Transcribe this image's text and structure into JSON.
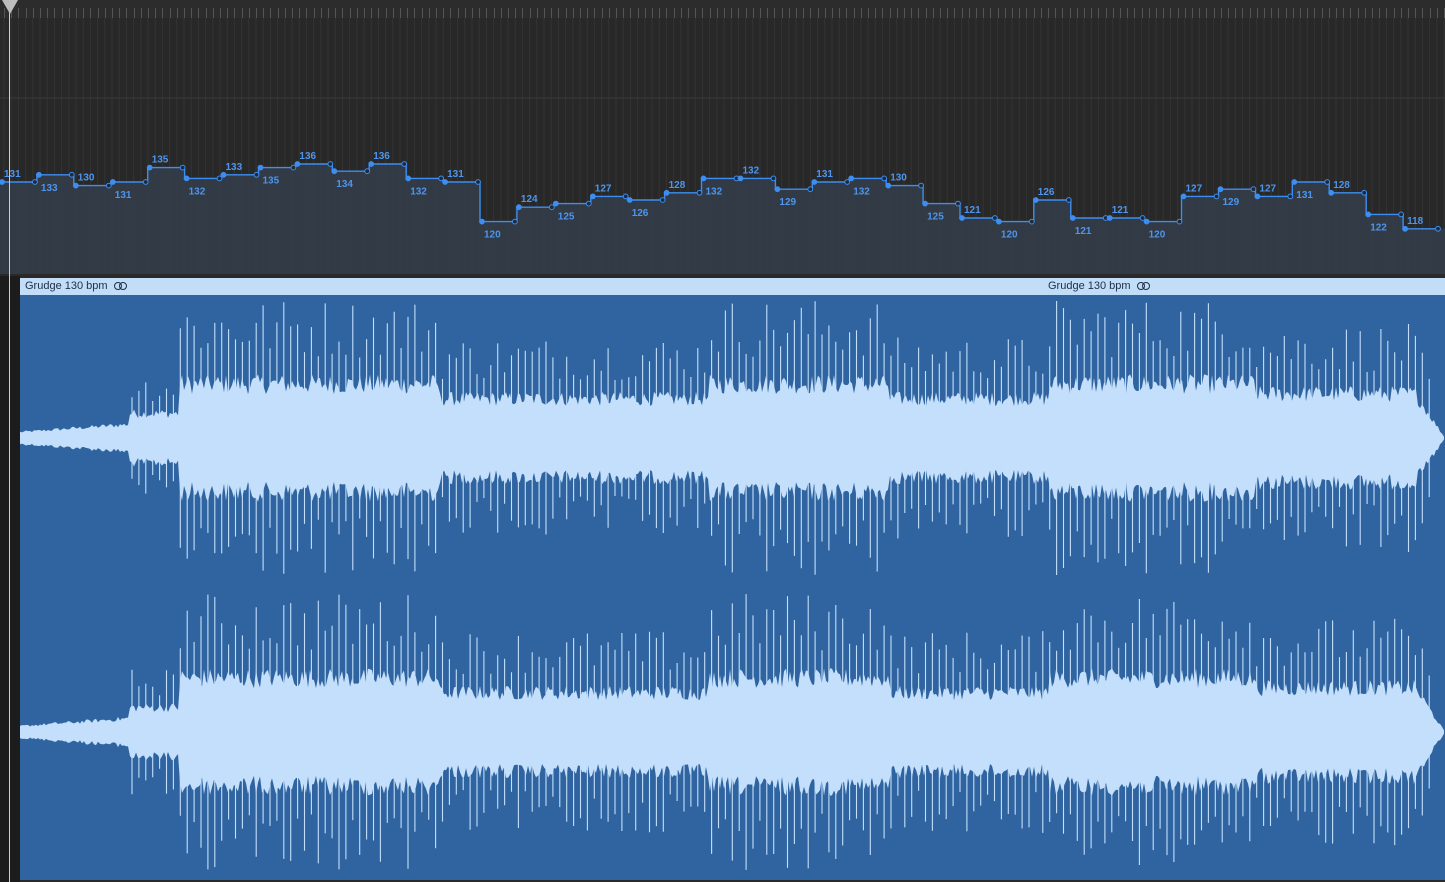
{
  "region": {
    "name": "Grudge 130 bpm",
    "repeat_name": "Grudge 130 bpm",
    "loop_icon": "loop-icon"
  },
  "tempo_track": {
    "labels": [
      "131",
      "133",
      "130",
      "131",
      "135",
      "132",
      "133",
      "135",
      "136",
      "134",
      "136",
      "132",
      "131",
      "120",
      "124",
      "125",
      "127",
      "126",
      "128",
      "132",
      "132",
      "129",
      "131",
      "132",
      "130",
      "125",
      "121",
      "120",
      "126",
      "121",
      "121",
      "120",
      "127",
      "129",
      "127",
      "131",
      "128",
      "122",
      "118"
    ]
  },
  "colors": {
    "background": "#282828",
    "tempo_line": "#3d8ef0",
    "tempo_label": "#4d95ee",
    "region_fill": "#2f64a0",
    "region_header": "#c2ddf8",
    "waveform": "#c3dffb"
  }
}
